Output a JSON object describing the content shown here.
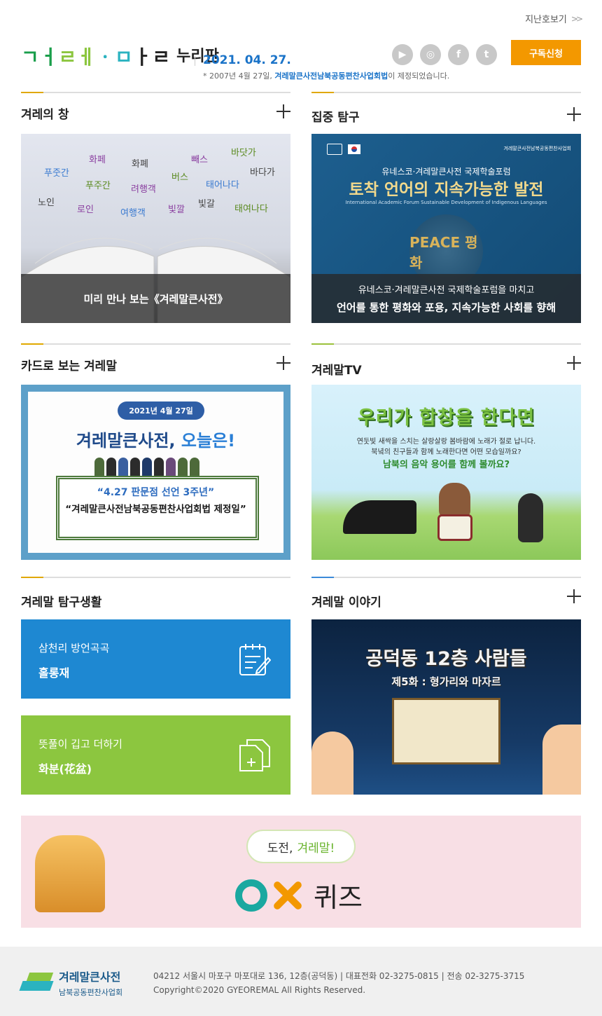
{
  "header": {
    "back_issues": "지난호보기",
    "back_chevron": ">>",
    "logo_mark": [
      "ㄱㅓ",
      "ㄹㅔ",
      "ㆍㅁ",
      "ㅏㄹ"
    ],
    "logo_sub": "누리판",
    "issue_date": "2021. 04. 27.",
    "issue_note_prefix": "* 2007년 4월 27일, ",
    "issue_note_bold": "겨레말큰사전남북공동편찬사업회법",
    "issue_note_suffix": "이 제정되었습니다.",
    "sns": [
      {
        "name": "youtube-icon",
        "glyph": "▶"
      },
      {
        "name": "instagram-icon",
        "glyph": "◎"
      },
      {
        "name": "facebook-icon",
        "glyph": "f"
      },
      {
        "name": "twitter-icon",
        "glyph": "t"
      }
    ],
    "subscribe": "구독신청"
  },
  "sections": {
    "window": {
      "title": "겨레의 창",
      "words": [
        "화페",
        "화폐",
        "빼스",
        "바닷가",
        "푸줏간",
        "버스",
        "바다가",
        "푸주간",
        "려행객",
        "태어나다",
        "노인",
        "로인",
        "여행객",
        "빛깔",
        "빛갈",
        "태여나다"
      ],
      "caption": "미리 만나 보는《겨레말큰사전》"
    },
    "explore": {
      "title": "집중 탐구",
      "org_right": "겨레말큰사전남북공동편찬사업회",
      "forum_sub": "유네스코·겨레말큰사전 국제학술포럼",
      "forum_title": "토착 언어의 지속가능한 발전",
      "forum_en": "International Academic Forum Sustainable Development of Indigenous Languages",
      "globe_text": "PEACE 평화",
      "caption_l1": "유네스코·겨레말큰사전 국제학술포럼을 마치고",
      "caption_l2": "언어를 통한 평화와 포용, 지속가능한 사회를 향해"
    },
    "cards": {
      "title": "카드로 보는 겨레말",
      "pill": "2021년 4월 27일",
      "big_a": "겨레말큰사전, ",
      "big_b": "오늘은!",
      "q1": "“4.27 판문점 선언 3주년”",
      "q2": "“겨레말큰사전남북공동편찬사업회법 제정일”"
    },
    "tv": {
      "title": "겨레말TV",
      "t_title": "우리가 합창을 한다면",
      "t_l1": "연둣빛 새싹을 스치는 살랑살랑 봄바람에 노래가 절로 납니다.",
      "t_l2": "북녘의 친구들과 함께 노래한다면 어떤 모습일까요?",
      "t_l3": "남북의 음악 용어를 함께 볼까요?"
    },
    "life": {
      "title": "겨레말 탐구생활",
      "box1_l1": "삼천리 방언곡곡",
      "box1_l2": "홀롱재",
      "box2_l1": "뜻풀이 깁고 더하기",
      "box2_l2": "화분(花盆)"
    },
    "story": {
      "title": "겨레말 이야기",
      "s_title": "공덕동 12층 사람들",
      "s_sub": "제5화 : 형가리와 마자르"
    }
  },
  "quiz": {
    "bubble_a": "도전,",
    "bubble_b": "겨레말!",
    "text": "퀴즈"
  },
  "footer": {
    "org_name": "겨레말큰사전",
    "org_sub": "남북공동편찬사업회",
    "address": "04212 서울시 마포구 마포대로 136, 12층(공덕동) | 대표전화 02-3275-0815 | 전송 02-3275-3715",
    "copyright": "Copyright©2020 GYEOREMAL All Rights Reserved."
  }
}
